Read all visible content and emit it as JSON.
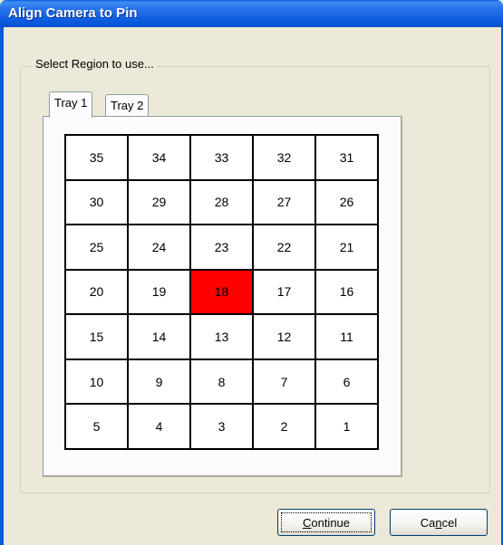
{
  "window": {
    "title": "Align Camera to Pin"
  },
  "group": {
    "label": "Select Region to use..."
  },
  "tabs": [
    {
      "label": "Tray 1",
      "active": true
    },
    {
      "label": "Tray 2",
      "active": false
    }
  ],
  "regions": {
    "rows": [
      [
        "35",
        "34",
        "33",
        "32",
        "31"
      ],
      [
        "30",
        "29",
        "28",
        "27",
        "26"
      ],
      [
        "25",
        "24",
        "23",
        "22",
        "21"
      ],
      [
        "20",
        "19",
        "18",
        "17",
        "16"
      ],
      [
        "15",
        "14",
        "13",
        "12",
        "11"
      ],
      [
        "10",
        "9",
        "8",
        "7",
        "6"
      ],
      [
        "5",
        "4",
        "3",
        "2",
        "1"
      ]
    ],
    "selected": "18",
    "selected_color": "#ff0000"
  },
  "buttons": {
    "continue": {
      "label": "Continue",
      "mnemonic": "C"
    },
    "cancel": {
      "label": "Cancel",
      "mnemonic": "n"
    }
  },
  "colors": {
    "title_bar": "#0c5ce0",
    "dialog_face": "#ece9d8"
  }
}
